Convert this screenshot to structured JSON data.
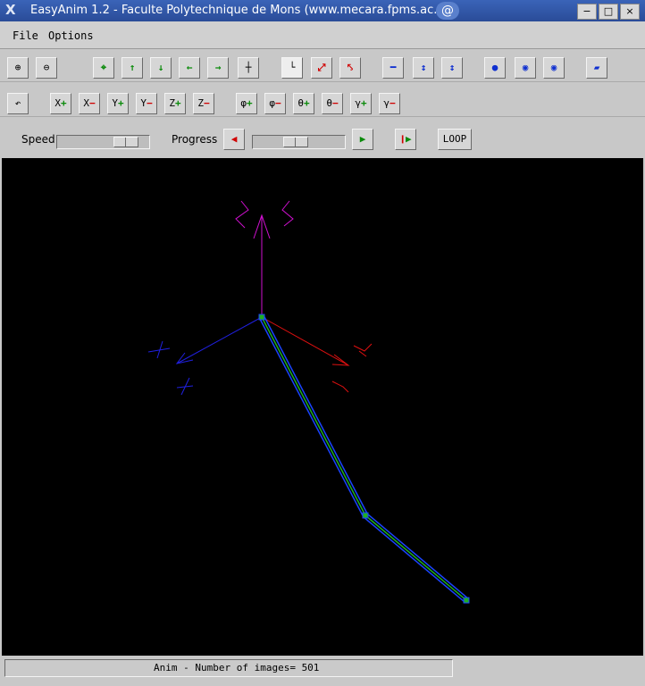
{
  "window": {
    "title": "EasyAnim 1.2 - Faculte Polytechnique de Mons (www.mecara.fpms.ac.be)",
    "app_icon": "x-icon",
    "system_icon": "swirl-icon",
    "controls": {
      "minimize": "−",
      "maximize": "□",
      "close": "×"
    }
  },
  "menubar": {
    "file": "File",
    "options": "Options"
  },
  "toolbar1": [
    {
      "name": "zoom-in-button",
      "icon": "magnifier-plus-icon",
      "glyph": "⊕",
      "color": "k"
    },
    {
      "name": "zoom-out-button",
      "icon": "magnifier-minus-icon",
      "glyph": "⊖",
      "color": "k"
    },
    {
      "name": "center-button",
      "icon": "crosshair-icon",
      "glyph": "⌖",
      "color": "g"
    },
    {
      "name": "pan-up-button",
      "icon": "arrow-up-icon",
      "glyph": "↑",
      "color": "g"
    },
    {
      "name": "pan-down-button",
      "icon": "arrow-down-icon",
      "glyph": "↓",
      "color": "g"
    },
    {
      "name": "pan-left-button",
      "icon": "arrow-left-icon",
      "glyph": "←",
      "color": "g"
    },
    {
      "name": "pan-right-button",
      "icon": "arrow-right-icon",
      "glyph": "→",
      "color": "g"
    },
    {
      "name": "axes-view-button",
      "icon": "axes-icon",
      "glyph": "┼",
      "color": "k"
    },
    {
      "name": "frame-toggle-button",
      "icon": "frame-icon",
      "glyph": "└",
      "color": "k"
    },
    {
      "name": "expand-button",
      "icon": "expand-icon",
      "glyph": "⤢",
      "color": "r"
    },
    {
      "name": "shrink-button",
      "icon": "shrink-icon",
      "glyph": "⤣",
      "color": "r"
    },
    {
      "name": "bar-thickness-button",
      "icon": "bar-icon",
      "glyph": "━",
      "color": "b"
    },
    {
      "name": "bar-thicker-button",
      "icon": "bar-expand-icon",
      "glyph": "↕",
      "color": "b"
    },
    {
      "name": "bar-thinner-button",
      "icon": "bar-shrink-icon",
      "glyph": "↕",
      "color": "b"
    },
    {
      "name": "node-button",
      "icon": "dot-icon",
      "glyph": "●",
      "color": "b"
    },
    {
      "name": "node-larger-button",
      "icon": "dot-expand-icon",
      "glyph": "◉",
      "color": "b"
    },
    {
      "name": "node-smaller-button",
      "icon": "dot-shrink-icon",
      "glyph": "◉",
      "color": "b"
    },
    {
      "name": "solid-render-button",
      "icon": "parallelogram-icon",
      "glyph": "▰",
      "color": "b"
    }
  ],
  "toolbar2": [
    {
      "name": "undo-view-button",
      "icon": "undo-arrow-icon",
      "label": "↶"
    },
    {
      "name": "x-plus-button",
      "label": "X",
      "sign": "+"
    },
    {
      "name": "x-minus-button",
      "label": "X",
      "sign": "−"
    },
    {
      "name": "y-plus-button",
      "label": "Y",
      "sign": "+"
    },
    {
      "name": "y-minus-button",
      "label": "Y",
      "sign": "−"
    },
    {
      "name": "z-plus-button",
      "label": "Z",
      "sign": "+"
    },
    {
      "name": "z-minus-button",
      "label": "Z",
      "sign": "−"
    },
    {
      "name": "phi-plus-button",
      "label": "φ",
      "sign": "+"
    },
    {
      "name": "phi-minus-button",
      "label": "φ",
      "sign": "−"
    },
    {
      "name": "theta-plus-button",
      "label": "θ",
      "sign": "+"
    },
    {
      "name": "theta-minus-button",
      "label": "θ",
      "sign": "−"
    },
    {
      "name": "gamma-plus-button",
      "label": "γ",
      "sign": "+"
    },
    {
      "name": "gamma-minus-button",
      "label": "γ",
      "sign": "−"
    }
  ],
  "anim": {
    "speed_label": "Speed",
    "progress_label": "Progress",
    "speed_value": 0.84,
    "progress_value": 0.45,
    "step_back_icon": "triangle-left-icon",
    "step_forward_icon": "triangle-right-icon",
    "play_icon": "play-icon",
    "loop_label": "LOOP"
  },
  "colors": {
    "canvas": "#000000",
    "axis_x": "#e01010",
    "axis_y": "#2020e0",
    "axis_z": "#d010d0",
    "link_outline": "#1a44ff",
    "link_core": "#20b020"
  },
  "status": {
    "text": "Anim - Number of images= 501"
  }
}
